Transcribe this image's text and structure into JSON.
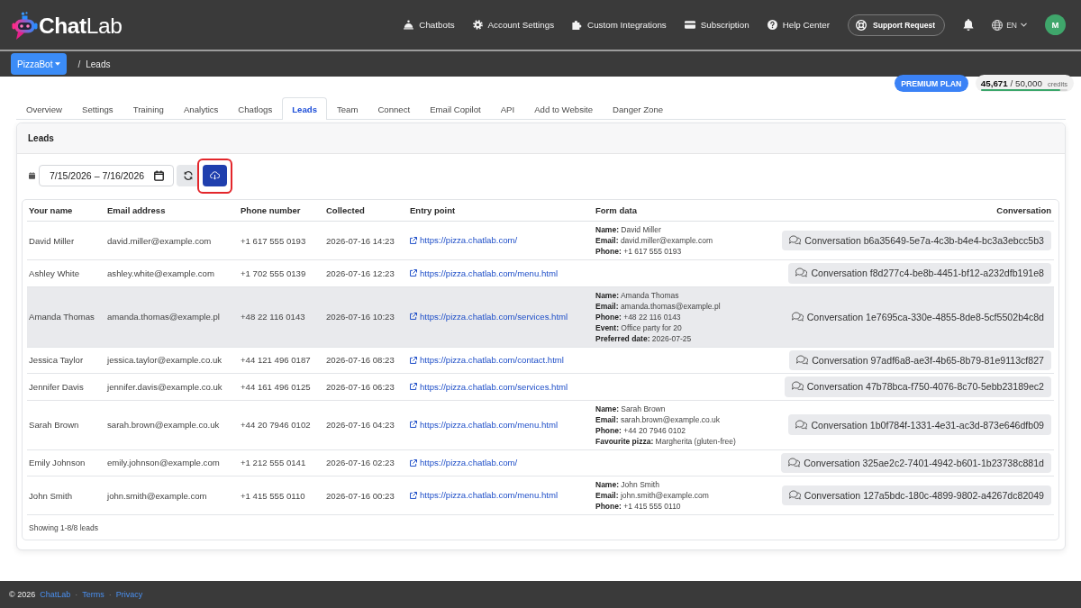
{
  "navbar": {
    "logo": "**Chat**Lab",
    "links": [
      "Chatbots",
      "Account Settings",
      "Custom Integrations",
      "Subscription",
      "Help Center"
    ],
    "support_button": "Support Request",
    "language": "EN",
    "avatar": "M"
  },
  "breadcrumb": {
    "bot_menu": "PizzaBot",
    "separator": "/",
    "page": "Leads"
  },
  "plan": {
    "badge": "PREMIUM PLAN",
    "credits": {
      "count": "**45,671** / 50,000",
      "unit": "credits",
      "level": 0.913
    }
  },
  "tabs": [
    {
      "label": "Overview",
      "selected": false
    },
    {
      "label": "Settings",
      "selected": false
    },
    {
      "label": "Training",
      "selected": false
    },
    {
      "label": "Analytics",
      "selected": false
    },
    {
      "label": "Chatlogs",
      "selected": false
    },
    {
      "label": "Leads",
      "selected": true
    },
    {
      "label": "Team",
      "selected": false
    },
    {
      "label": "Connect",
      "selected": false
    },
    {
      "label": "Email Copilot",
      "selected": false
    },
    {
      "label": "API",
      "selected": false
    },
    {
      "label": "Add to Website",
      "selected": false
    },
    {
      "label": "Danger Zone",
      "selected": false
    }
  ],
  "leads_panel": {
    "title": "Leads",
    "date_range": "7/15/2026 – 7/16/2026",
    "export_button": {
      "highlighted": true
    },
    "table": {
      "columns": [
        "Your name",
        "Email address",
        "Phone number",
        "Collected",
        "Entry point",
        "Form data",
        "Conversation"
      ],
      "rows": [
        {
          "name": "David Miller",
          "email": "david.miller@example.com",
          "phone": "+1 617 555 0193",
          "collected": "2026-07-16 14:23",
          "entry_point": "https://pizza.chatlab.com/",
          "form_data": [
            "**Name:** David Miller",
            "**Email:** david.miller@example.com",
            "**Phone:** +1 617 555 0193"
          ],
          "conversation": "Conversation b6a35649-5e7a-4c3b-b4e4-bc3a3ebcc5b3",
          "selected": false
        },
        {
          "name": "Ashley White",
          "email": "ashley.white@example.com",
          "phone": "+1 702 555 0139",
          "collected": "2026-07-16 12:23",
          "entry_point": "https://pizza.chatlab.com/menu.html",
          "conversation": "Conversation f8d277c4-be8b-4451-bf12-a232dfb191e8",
          "selected": false
        },
        {
          "name": "Amanda Thomas",
          "email": "amanda.thomas@example.pl",
          "phone": "+48 22 116 0143",
          "collected": "2026-07-16 10:23",
          "entry_point": "https://pizza.chatlab.com/services.html",
          "form_data": [
            "**Name:** Amanda Thomas",
            "**Email:** amanda.thomas@example.pl",
            "**Phone:** +48 22 116 0143",
            "**Event:** Office party for 20",
            "**Preferred date:** 2026-07-25"
          ],
          "conversation": "Conversation 1e7695ca-330e-4855-8de8-5cf5502b4c8d",
          "selected": true
        },
        {
          "name": "Jessica Taylor",
          "email": "jessica.taylor@example.co.uk",
          "phone": "+44 121 496 0187",
          "collected": "2026-07-16 08:23",
          "entry_point": "https://pizza.chatlab.com/contact.html",
          "conversation": "Conversation 97adf6a8-ae3f-4b65-8b79-81e9113cf827",
          "selected": false
        },
        {
          "name": "Jennifer Davis",
          "email": "jennifer.davis@example.co.uk",
          "phone": "+44 161 496 0125",
          "collected": "2026-07-16 06:23",
          "entry_point": "https://pizza.chatlab.com/services.html",
          "conversation": "Conversation 47b78bca-f750-4076-8c70-5ebb23189ec2",
          "selected": false
        },
        {
          "name": "Sarah Brown",
          "email": "sarah.brown@example.co.uk",
          "phone": "+44 20 7946 0102",
          "collected": "2026-07-16 04:23",
          "entry_point": "https://pizza.chatlab.com/menu.html",
          "form_data": [
            "**Name:** Sarah Brown",
            "**Email:** sarah.brown@example.co.uk",
            "**Phone:** +44 20 7946 0102",
            "**Favourite pizza:** Margherita (gluten-free)"
          ],
          "conversation": "Conversation 1b0f784f-1331-4e31-ac3d-873e646dfb09",
          "selected": false
        },
        {
          "name": "Emily Johnson",
          "email": "emily.johnson@example.com",
          "phone": "+1 212 555 0141",
          "collected": "2026-07-16 02:23",
          "entry_point": "https://pizza.chatlab.com/",
          "conversation": "Conversation 325ae2c2-7401-4942-b601-1b23738c881d",
          "selected": false
        },
        {
          "name": "John Smith",
          "email": "john.smith@example.com",
          "phone": "+1 415 555 0110",
          "collected": "2026-07-16 00:23",
          "entry_point": "https://pizza.chatlab.com/menu.html",
          "form_data": [
            "**Name:** John Smith",
            "**Email:** john.smith@example.com",
            "**Phone:** +1 415 555 0110"
          ],
          "conversation": "Conversation 127a5bdc-180c-4899-9802-a4267dc82049",
          "selected": false
        }
      ]
    },
    "summary": "Showing 1-8/8 leads"
  },
  "footer": {
    "items": [
      {
        "kind": "text",
        "text": "© 2026"
      },
      {
        "kind": "link",
        "text": "ChatLab"
      },
      {
        "kind": "separator",
        "text": "·"
      },
      {
        "kind": "link",
        "text": "Terms"
      },
      {
        "kind": "separator",
        "text": "·"
      },
      {
        "kind": "link",
        "text": "Privacy"
      }
    ]
  }
}
